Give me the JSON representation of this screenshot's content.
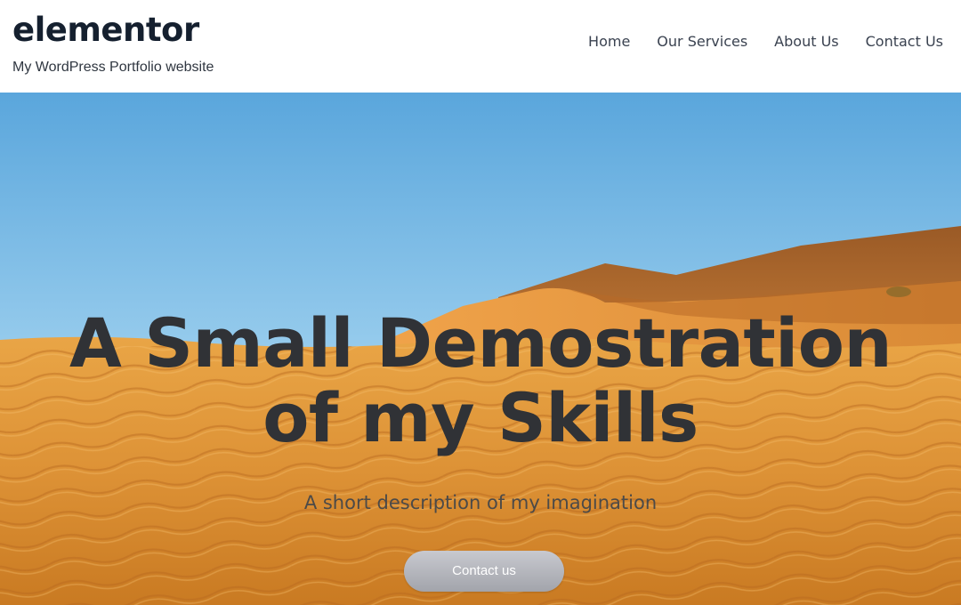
{
  "header": {
    "site_title": "elementor",
    "tagline": "My WordPress Portfolio website",
    "nav": [
      {
        "label": "Home"
      },
      {
        "label": "Our Services"
      },
      {
        "label": "About Us"
      },
      {
        "label": "Contact Us"
      }
    ]
  },
  "hero": {
    "title_line1": "A Small Demostration",
    "title_line2": "of my Skills",
    "subtitle": "A short description of my imagination",
    "button_label": "Contact us",
    "background": "desert-dunes-image"
  },
  "colors": {
    "sky_top": "#5aa6dc",
    "sky_bottom": "#cfe8f7",
    "sand": "#e0953a",
    "text_dark": "#303236",
    "button": "#b5b7bd"
  }
}
